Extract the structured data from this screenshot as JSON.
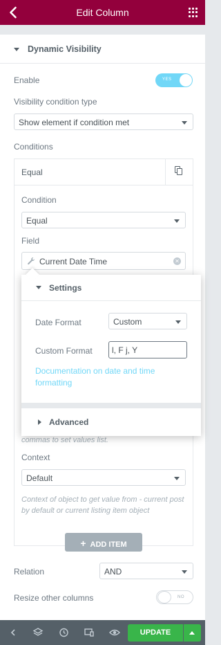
{
  "header": {
    "title": "Edit Column"
  },
  "section": {
    "title": "Dynamic Visibility"
  },
  "enable": {
    "label": "Enable",
    "toggle_text": "YES",
    "checked": true
  },
  "visibility_type": {
    "label": "Visibility condition type",
    "value": "Show element if condition met"
  },
  "conditions": {
    "label": "Conditions"
  },
  "condition_item": {
    "title": "Equal",
    "condition_label": "Condition",
    "condition_value": "Equal",
    "field_label": "Field",
    "field_value": "Current Date Time",
    "values_hint_tail": "commas to set values list.",
    "context_label": "Context",
    "context_value": "Default",
    "context_hint": "Context of object to get value from - current post by default or current listing item object"
  },
  "popover": {
    "settings_title": "Settings",
    "date_format_label": "Date Format",
    "date_format_value": "Custom",
    "custom_format_label": "Custom Format",
    "custom_format_value": "l, F j, Y",
    "doc_link": "Documentation on date and time formatting",
    "advanced_title": "Advanced"
  },
  "add_item": {
    "label": "ADD ITEM"
  },
  "relation": {
    "label": "Relation",
    "value": "AND"
  },
  "resize": {
    "label": "Resize other columns",
    "toggle_text": "NO",
    "checked": false
  },
  "footer": {
    "update_label": "UPDATE"
  },
  "colors": {
    "header": "#93003c",
    "accent": "#71d7f7",
    "update": "#39b54a",
    "footer": "#556068"
  }
}
